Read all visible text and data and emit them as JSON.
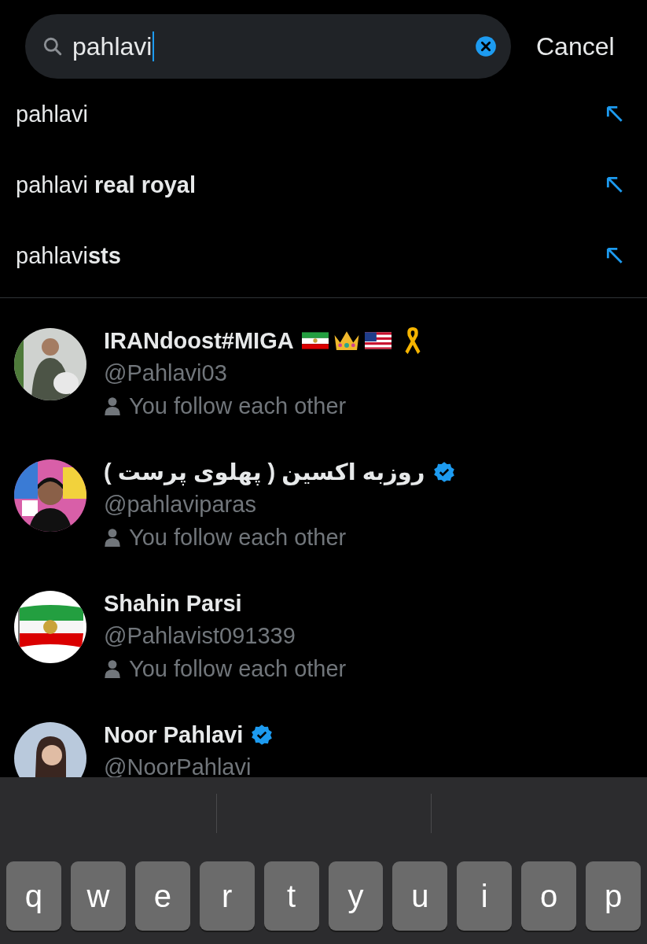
{
  "search": {
    "value": "pahlavi",
    "cancel": "Cancel"
  },
  "suggestions": [
    {
      "text": "pahlavi"
    },
    {
      "text": "pahlavi **real royal**"
    },
    {
      "text": "pahlavi**sts**"
    }
  ],
  "users": [
    {
      "name": "IRANdoost#MIGA",
      "verified": false,
      "badges": [
        {
          "kind": "flag-lion"
        },
        {
          "kind": "crown"
        },
        {
          "kind": "flag-stripes"
        },
        {
          "kind": "ribbon"
        }
      ],
      "handle": "@Pahlavi03",
      "relation": "You follow each other"
    },
    {
      "name": "روزبه اکسین ( پهلوی پرست )",
      "verified": true,
      "handle": "@pahlaviparas",
      "relation": "You follow each other"
    },
    {
      "name": "Shahin Parsi",
      "verified": false,
      "handle": "@Pahlavist091339",
      "relation": "You follow each other"
    },
    {
      "name": "Noor Pahlavi",
      "verified": true,
      "handle": "@NoorPahlavi"
    }
  ],
  "keyboard": {
    "keys": [
      "q",
      "w",
      "e",
      "r",
      "t",
      "y",
      "u",
      "i",
      "o",
      "p"
    ]
  }
}
